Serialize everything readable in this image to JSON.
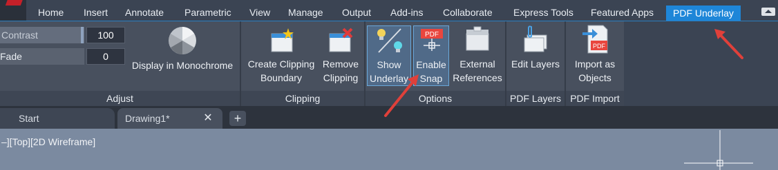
{
  "tabs": [
    "Home",
    "Insert",
    "Annotate",
    "Parametric",
    "View",
    "Manage",
    "Output",
    "Add-ins",
    "Collaborate",
    "Express Tools",
    "Featured Apps",
    "PDF Underlay"
  ],
  "adjust": {
    "contrast_label": "Contrast",
    "contrast_value": "100",
    "fade_label": "Fade",
    "fade_value": "0",
    "monochrome_label": "Display in Monochrome",
    "title": "Adjust"
  },
  "clipping": {
    "create_label": "Create Clipping Boundary",
    "remove_label": "Remove Clipping",
    "title": "Clipping"
  },
  "options": {
    "show_underlay_label": "Show Underlay",
    "enable_snap_label": "Enable Snap",
    "snap_badge": "PDF",
    "external_refs_label": "External References",
    "title": "Options"
  },
  "pdf_layers": {
    "edit_layers_label": "Edit Layers",
    "title": "PDF Layers"
  },
  "pdf_import": {
    "import_label": "Import as Objects",
    "badge": "PDF",
    "title": "PDF Import"
  },
  "doc_tabs": {
    "start": "Start",
    "drawing": "Drawing1*",
    "close": "✕",
    "new": "+"
  },
  "viewport": {
    "label": "–][Top][2D Wireframe]"
  },
  "colors": {
    "accent": "#1e86d8",
    "annotation_arrow": "#e0403a",
    "ribbon_bg": "#3b4453",
    "panel_bg": "#48505e",
    "viewport_bg": "#7b8aa0"
  },
  "states": {
    "show_underlay_active": true,
    "enable_snap_active": true,
    "active_tab": "PDF Underlay"
  }
}
